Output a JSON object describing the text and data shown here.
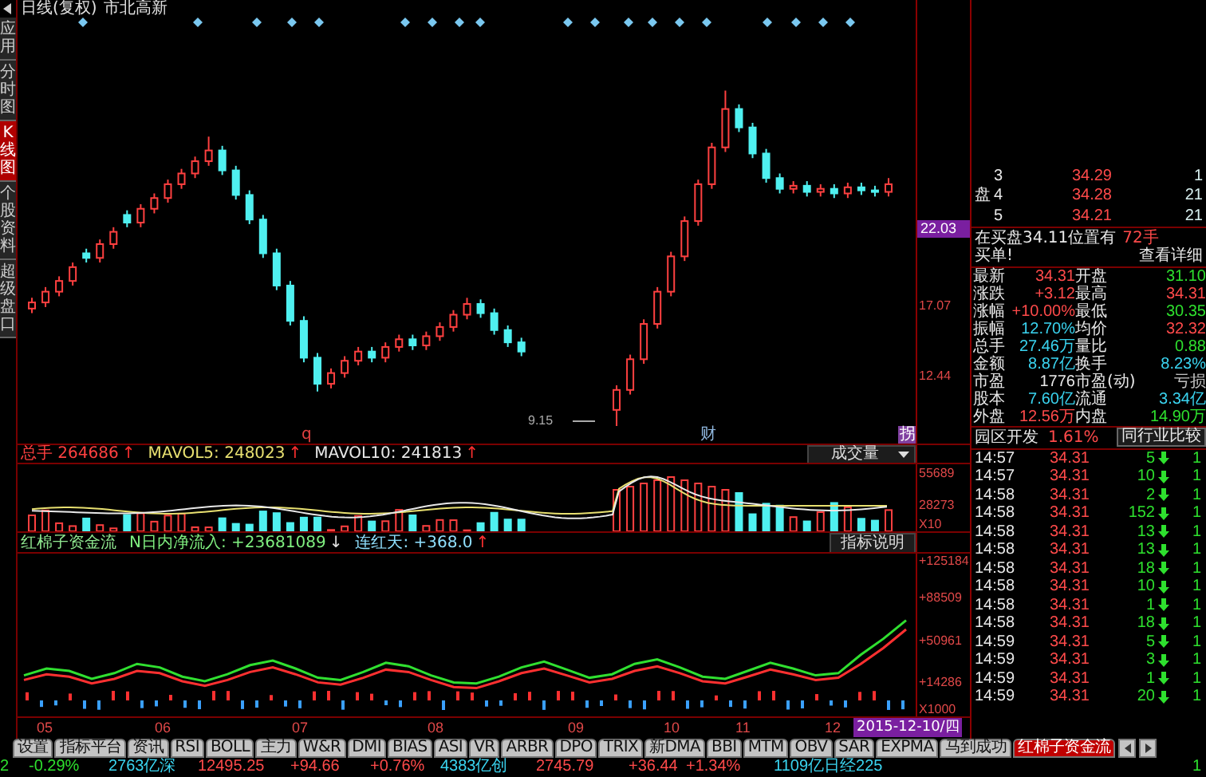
{
  "sidebar": {
    "items": [
      {
        "label": "应用",
        "selected": false
      },
      {
        "label": "分时图",
        "selected": false
      },
      {
        "label": "K线图",
        "selected": true
      },
      {
        "label": "个股资料",
        "selected": false
      },
      {
        "label": "超级盘口",
        "selected": false
      }
    ]
  },
  "chart": {
    "period": "日线(复权)",
    "stock_name": "市北高新",
    "cursor_price": "22.03",
    "chart_data": {
      "type": "candlestick",
      "ylim": [
        7.8,
        36.9
      ],
      "yticks": [
        {
          "value": 17.07,
          "label": "17.07"
        },
        {
          "value": 12.44,
          "label": "12.44"
        }
      ],
      "ohlc": [
        [
          16.8,
          17.5,
          16.5,
          17.2
        ],
        [
          17.2,
          18.2,
          16.9,
          17.9
        ],
        [
          17.9,
          18.9,
          17.6,
          18.6
        ],
        [
          18.6,
          19.8,
          18.3,
          19.5
        ],
        [
          20.4,
          20.7,
          19.8,
          20.1
        ],
        [
          20.1,
          21.3,
          19.8,
          21.0
        ],
        [
          21.0,
          22.1,
          20.7,
          21.8
        ],
        [
          22.9,
          23.2,
          22.1,
          22.4
        ],
        [
          22.4,
          23.6,
          22.1,
          23.3
        ],
        [
          23.3,
          24.3,
          23.0,
          24.0
        ],
        [
          24.0,
          25.2,
          23.7,
          24.9
        ],
        [
          24.9,
          25.9,
          24.6,
          25.6
        ],
        [
          25.6,
          26.7,
          25.3,
          26.4
        ],
        [
          26.4,
          28.0,
          26.1,
          27.1
        ],
        [
          27.1,
          27.4,
          25.5,
          25.8
        ],
        [
          25.8,
          26.1,
          23.9,
          24.2
        ],
        [
          24.2,
          24.5,
          22.3,
          22.6
        ],
        [
          22.6,
          22.9,
          20.1,
          20.4
        ],
        [
          20.4,
          20.7,
          18.0,
          18.3
        ],
        [
          18.3,
          18.6,
          15.7,
          16.0
        ],
        [
          16.0,
          16.3,
          13.3,
          13.6
        ],
        [
          13.6,
          13.9,
          11.4,
          11.9
        ],
        [
          11.9,
          12.9,
          11.6,
          12.6
        ],
        [
          12.6,
          13.7,
          12.3,
          13.4
        ],
        [
          13.4,
          14.3,
          13.1,
          14.0
        ],
        [
          14.0,
          14.3,
          13.3,
          13.6
        ],
        [
          13.6,
          14.6,
          13.3,
          14.3
        ],
        [
          14.3,
          15.1,
          14.0,
          14.8
        ],
        [
          14.8,
          15.1,
          14.1,
          14.4
        ],
        [
          14.4,
          15.3,
          14.1,
          15.0
        ],
        [
          15.0,
          15.9,
          14.7,
          15.6
        ],
        [
          15.6,
          16.7,
          15.3,
          16.4
        ],
        [
          16.4,
          17.5,
          16.1,
          17.1
        ],
        [
          17.1,
          17.4,
          16.2,
          16.5
        ],
        [
          16.5,
          16.8,
          15.1,
          15.4
        ],
        [
          15.4,
          15.7,
          14.3,
          14.6
        ],
        [
          14.6,
          14.9,
          13.7,
          14.0
        ],
        null,
        null,
        null,
        null,
        null,
        null,
        [
          10.2,
          11.8,
          9.15,
          11.5
        ],
        [
          11.5,
          13.8,
          11.2,
          13.5
        ],
        [
          13.5,
          16.1,
          13.2,
          15.8
        ],
        [
          15.8,
          18.2,
          15.5,
          17.9
        ],
        [
          17.9,
          20.5,
          17.6,
          20.2
        ],
        [
          20.2,
          22.8,
          19.9,
          22.5
        ],
        [
          22.5,
          25.2,
          22.2,
          24.9
        ],
        [
          24.9,
          27.6,
          24.6,
          27.3
        ],
        [
          27.3,
          31.0,
          27.0,
          29.8
        ],
        [
          29.8,
          30.1,
          28.3,
          28.6
        ],
        [
          28.6,
          28.9,
          26.6,
          26.9
        ],
        [
          26.9,
          27.2,
          25.0,
          25.3
        ],
        [
          25.3,
          25.6,
          24.3,
          24.6
        ],
        [
          24.6,
          25.1,
          24.3,
          24.8
        ],
        [
          24.8,
          25.1,
          24.1,
          24.4
        ],
        [
          24.4,
          24.9,
          24.1,
          24.6
        ],
        [
          24.6,
          24.9,
          24.0,
          24.3
        ],
        [
          24.3,
          25.0,
          24.0,
          24.7
        ],
        [
          24.7,
          25.0,
          24.2,
          24.5
        ],
        [
          24.5,
          24.8,
          24.1,
          24.4
        ],
        [
          24.4,
          25.3,
          24.1,
          24.9
        ]
      ]
    },
    "low_label": "9.15",
    "event_marks": [
      {
        "label": "q",
        "kind": "plain"
      },
      {
        "label": "财",
        "kind": "finance"
      },
      {
        "label": "拐",
        "kind": "boxed"
      }
    ],
    "volume": {
      "readings": [
        {
          "label": "总手",
          "value": "264686",
          "arrow": "↑",
          "kind": "rise",
          "color": "#ff4040"
        },
        {
          "label": "MAVOL5:",
          "value": "248023",
          "arrow": "↑",
          "kind": "rise",
          "color": "#e8e070"
        },
        {
          "label": "MAVOL10:",
          "value": "241813",
          "arrow": "↑",
          "kind": "rise",
          "color": "#e8e8e8"
        }
      ],
      "selector": "成交量",
      "axis": [
        "55689",
        "28273",
        "X10"
      ]
    },
    "indicator": {
      "name": "红棉子资金流",
      "readings": [
        {
          "label": "N日内净流入:",
          "value": "+23681089",
          "arrow": "↓",
          "kind": "fall"
        },
        {
          "label": "连红天:",
          "value": "+368.0",
          "arrow": "↑",
          "kind": "rise"
        }
      ],
      "help_button": "指标说明",
      "unit": "X1000",
      "chart_data": {
        "type": "line",
        "ylim": [
          -17000,
          126000
        ],
        "yticks": [
          {
            "value": 125184,
            "label": "+125184"
          },
          {
            "value": 88509,
            "label": "+88509"
          },
          {
            "value": 50961,
            "label": "+50961"
          },
          {
            "value": 14286,
            "label": "+14286"
          }
        ],
        "series": [
          {
            "color": "#30e030",
            "values": [
              20000,
              26000,
              24000,
              17000,
              22000,
              30000,
              27000,
              19000,
              15000,
              21000,
              29000,
              33000,
              26000,
              18000,
              16000,
              23000,
              31000,
              28000,
              20000,
              14000,
              13000,
              19000,
              27000,
              32000,
              25000,
              18000,
              21000,
              30000,
              34000,
              27000,
              19000,
              17000,
              24000,
              31000,
              26000,
              20000,
              22000,
              38000,
              52000,
              68000
            ]
          },
          {
            "color": "#ff3030",
            "values": [
              16000,
              21000,
              19000,
              13000,
              17000,
              24000,
              22000,
              15000,
              11000,
              16000,
              23000,
              27000,
              21000,
              14000,
              12000,
              18000,
              25000,
              23000,
              16000,
              10000,
              9000,
              15000,
              22000,
              26000,
              20000,
              14000,
              17000,
              24000,
              28000,
              22000,
              15000,
              13000,
              19000,
              25000,
              21000,
              16000,
              18000,
              30000,
              44000,
              60000
            ]
          }
        ]
      }
    },
    "x_axis": {
      "months": [
        "05",
        "06",
        "07",
        "08",
        "09",
        "10",
        "11",
        "12"
      ],
      "cursor_date": "2015-12-10/四"
    }
  },
  "quote": {
    "order_book": {
      "side_label": "盘",
      "rows": [
        {
          "rank": "3",
          "price": "34.29",
          "volume": "1"
        },
        {
          "rank": "4",
          "price": "34.28",
          "volume": "21"
        },
        {
          "rank": "5",
          "price": "34.21",
          "volume": "21"
        }
      ]
    },
    "notice": {
      "text": "在买盘34.11位置有",
      "quantity": "72手",
      "suffix": "买单!",
      "link": "查看详细"
    },
    "stats": [
      {
        "label": "最新",
        "value": "34.31",
        "kind": "up"
      },
      {
        "label": "开盘",
        "value": "31.10",
        "kind": "down"
      },
      {
        "label": "涨跌",
        "value": "+3.12",
        "kind": "up"
      },
      {
        "label": "最高",
        "value": "34.31",
        "kind": "up"
      },
      {
        "label": "涨幅",
        "value": "+10.00%",
        "kind": "up"
      },
      {
        "label": "最低",
        "value": "30.35",
        "kind": "down"
      },
      {
        "label": "振幅",
        "value": "12.70%",
        "kind": "info"
      },
      {
        "label": "均价",
        "value": "32.32",
        "kind": "up"
      },
      {
        "label": "总手",
        "value": "27.46万",
        "kind": "info"
      },
      {
        "label": "量比",
        "value": "0.88",
        "kind": "down"
      },
      {
        "label": "金额",
        "value": "8.87亿",
        "kind": "info"
      },
      {
        "label": "换手",
        "value": "8.23%",
        "kind": "info"
      },
      {
        "label": "市盈",
        "value": "1776",
        "kind": "plain"
      },
      {
        "label": "市盈(动)",
        "value": "亏损",
        "kind": "muted"
      },
      {
        "label": "股本",
        "value": "7.60亿",
        "kind": "info"
      },
      {
        "label": "流通",
        "value": "3.34亿",
        "kind": "info"
      },
      {
        "label": "外盘",
        "value": "12.56万",
        "kind": "up"
      },
      {
        "label": "内盘",
        "value": "14.90万",
        "kind": "down"
      }
    ],
    "sector": {
      "name": "园区开发",
      "change": "1.61%",
      "compare_button": "同行业比较"
    },
    "ticks": [
      {
        "time": "14:57",
        "price": "34.31",
        "volume": "5",
        "column_4": "1"
      },
      {
        "time": "14:57",
        "price": "34.31",
        "volume": "10",
        "column_4": "1"
      },
      {
        "time": "14:58",
        "price": "34.31",
        "volume": "2",
        "column_4": "1"
      },
      {
        "time": "14:58",
        "price": "34.31",
        "volume": "152",
        "column_4": "1"
      },
      {
        "time": "14:58",
        "price": "34.31",
        "volume": "13",
        "column_4": "1"
      },
      {
        "time": "14:58",
        "price": "34.31",
        "volume": "13",
        "column_4": "1"
      },
      {
        "time": "14:58",
        "price": "34.31",
        "volume": "18",
        "column_4": "1"
      },
      {
        "time": "14:58",
        "price": "34.31",
        "volume": "10",
        "column_4": "1"
      },
      {
        "time": "14:58",
        "price": "34.31",
        "volume": "1",
        "column_4": "1"
      },
      {
        "time": "14:58",
        "price": "34.31",
        "volume": "18",
        "column_4": "1"
      },
      {
        "time": "14:59",
        "price": "34.31",
        "volume": "5",
        "column_4": "1"
      },
      {
        "time": "14:59",
        "price": "34.31",
        "volume": "3",
        "column_4": "1"
      },
      {
        "time": "14:59",
        "price": "34.31",
        "volume": "1",
        "column_4": "1"
      },
      {
        "time": "14:59",
        "price": "34.31",
        "volume": "20",
        "column_4": "1"
      }
    ]
  },
  "tabs": [
    {
      "label": "设置",
      "selected": false
    },
    {
      "label": "指标平台",
      "selected": false
    },
    {
      "label": "资讯",
      "selected": false
    },
    {
      "label": "RSI",
      "selected": false
    },
    {
      "label": "BOLL",
      "selected": false
    },
    {
      "label": "主力",
      "selected": false
    },
    {
      "label": "W&R",
      "selected": false
    },
    {
      "label": "DMI",
      "selected": false
    },
    {
      "label": "BIAS",
      "selected": false
    },
    {
      "label": "ASI",
      "selected": false
    },
    {
      "label": "VR",
      "selected": false
    },
    {
      "label": "ARBR",
      "selected": false
    },
    {
      "label": "DPO",
      "selected": false
    },
    {
      "label": "TRIX",
      "selected": false
    },
    {
      "label": "新DMA",
      "selected": false
    },
    {
      "label": "BBI",
      "selected": false
    },
    {
      "label": "MTM",
      "selected": false
    },
    {
      "label": "OBV",
      "selected": false
    },
    {
      "label": "SAR",
      "selected": false
    },
    {
      "label": "EXPMA",
      "selected": false
    },
    {
      "label": "马到成功",
      "selected": false
    },
    {
      "label": "红棉子资金流",
      "selected": true
    }
  ],
  "status_bar": [
    {
      "text": "2",
      "kind": "down"
    },
    {
      "text": "-0.29%",
      "kind": "down"
    },
    {
      "text": "2763亿深",
      "kind": "info"
    },
    {
      "text": "12495.25",
      "kind": "up"
    },
    {
      "text": "+94.66",
      "kind": "up"
    },
    {
      "text": "+0.76%",
      "kind": "up"
    },
    {
      "text": "4383亿创",
      "kind": "info"
    },
    {
      "text": "2745.79",
      "kind": "up"
    },
    {
      "text": "+36.44",
      "kind": "up"
    },
    {
      "text": "+1.34%",
      "kind": "up"
    },
    {
      "text": "1109亿日经225",
      "kind": "info"
    },
    {
      "text": "1",
      "kind": "down"
    }
  ]
}
